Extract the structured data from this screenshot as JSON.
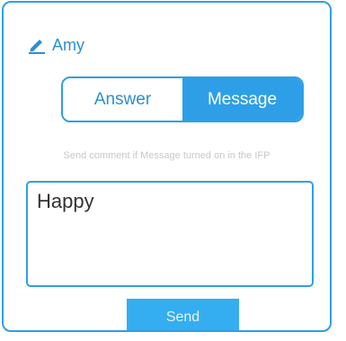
{
  "user": {
    "name": "Amy",
    "icon": "edit-icon"
  },
  "tabs": {
    "answer_label": "Answer",
    "message_label": "Message",
    "selected": "Message"
  },
  "hint_text": "Send comment if Message turned on in the IFP",
  "message_box": {
    "value": "Happy"
  },
  "send_label": "Send",
  "colors": {
    "accent": "#2e9fe6",
    "send_button": "#34aef0",
    "hint": "#c4c9cd"
  }
}
